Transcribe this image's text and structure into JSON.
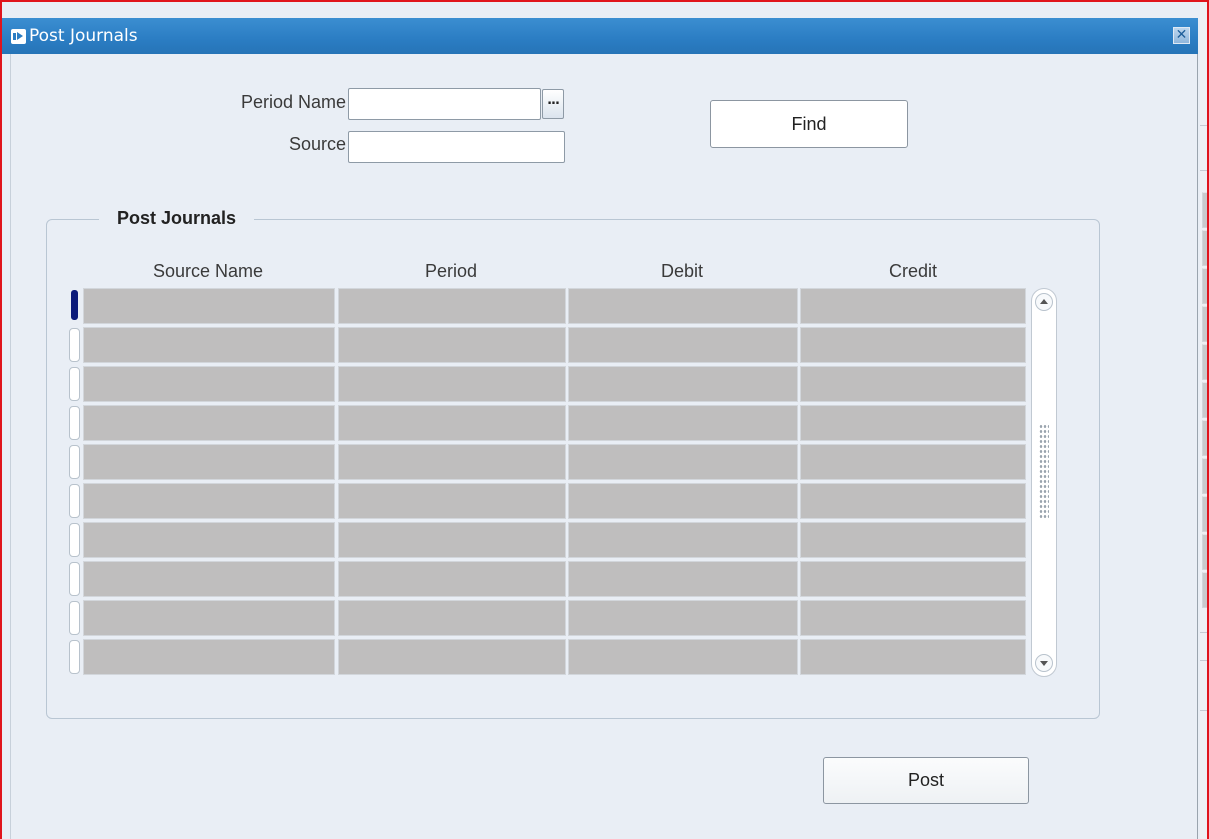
{
  "window": {
    "title": "Post Journals",
    "close_icon": "close-icon",
    "title_icon": "form-icon",
    "accent_color": "#2b7dc3"
  },
  "search": {
    "period_name_label": "Period Name",
    "period_name_value": "",
    "lov_label": "...",
    "source_label": "Source",
    "source_value": "",
    "find_label": "Find"
  },
  "group": {
    "title": "Post Journals",
    "columns": [
      "Source Name",
      "Period",
      "Debit",
      "Credit"
    ],
    "rows": [
      [
        "",
        "",
        "",
        ""
      ],
      [
        "",
        "",
        "",
        ""
      ],
      [
        "",
        "",
        "",
        ""
      ],
      [
        "",
        "",
        "",
        ""
      ],
      [
        "",
        "",
        "",
        ""
      ],
      [
        "",
        "",
        "",
        ""
      ],
      [
        "",
        "",
        "",
        ""
      ],
      [
        "",
        "",
        "",
        ""
      ],
      [
        "",
        "",
        "",
        ""
      ],
      [
        "",
        "",
        "",
        ""
      ]
    ]
  },
  "footer": {
    "post_label": "Post"
  }
}
